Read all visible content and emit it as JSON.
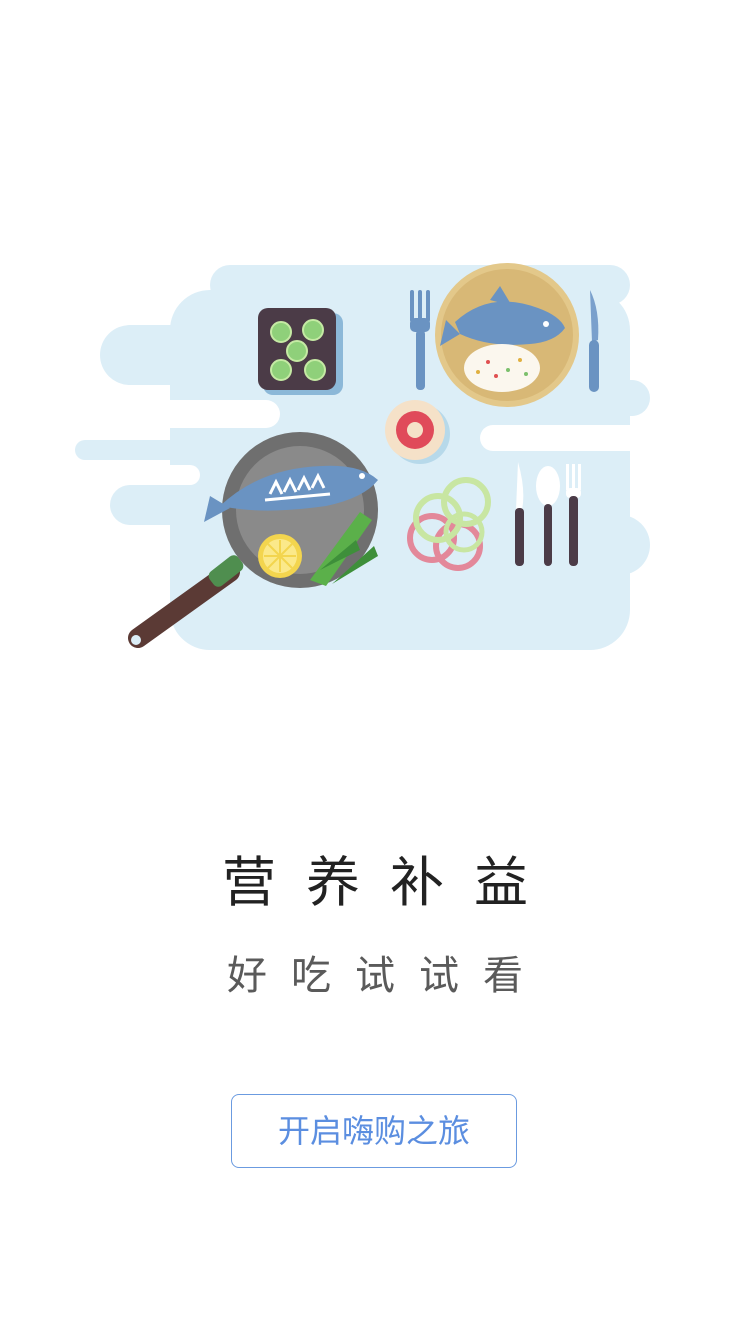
{
  "main": {
    "title": "营养补益",
    "subtitle": "好吃试试看",
    "start_button_label": "开启嗨购之旅"
  },
  "illustration": {
    "icon": "food-table-illustration"
  },
  "colors": {
    "title": "#222222",
    "subtitle": "#5a5a5a",
    "button_border": "#6b9be0",
    "button_text": "#5b8ee0",
    "cloud_background": "#dceef7"
  }
}
